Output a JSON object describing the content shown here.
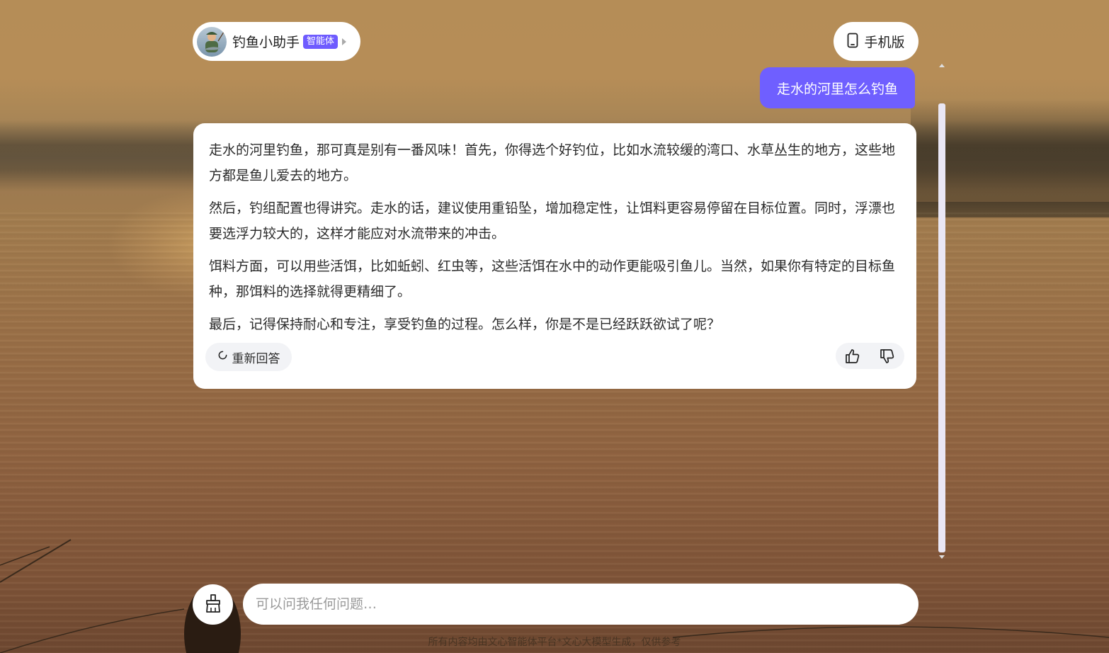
{
  "header": {
    "agent_name": "钓鱼小助手",
    "agent_badge": "智能体",
    "mobile_label": "手机版"
  },
  "conversation": {
    "user_message": "走水的河里怎么钓鱼",
    "answer_paragraphs": [
      "走水的河里钓鱼，那可真是别有一番风味！首先，你得选个好钓位，比如水流较缓的湾口、水草丛生的地方，这些地方都是鱼儿爱去的地方。",
      "然后，钓组配置也得讲究。走水的话，建议使用重铅坠，增加稳定性，让饵料更容易停留在目标位置。同时，浮漂也要选浮力较大的，这样才能应对水流带来的冲击。",
      "饵料方面，可以用些活饵，比如蚯蚓、红虫等，这些活饵在水中的动作更能吸引鱼儿。当然，如果你有特定的目标鱼种，那饵料的选择就得更精细了。",
      "最后，记得保持耐心和专注，享受钓鱼的过程。怎么样，你是不是已经跃跃欲试了呢？"
    ],
    "regenerate_label": "重新回答"
  },
  "input": {
    "placeholder": "可以问我任何问题…"
  },
  "footer": {
    "note": "所有内容均由文心智能体平台*文心大模型生成，仅供参考"
  },
  "icons": {
    "mobile": "mobile-phone-icon",
    "regenerate": "refresh-icon",
    "like": "thumbs-up-icon",
    "dislike": "thumbs-down-icon",
    "clear": "broom-icon"
  },
  "colors": {
    "accent": "#6f5fff",
    "badge": "#6e5bff",
    "card_bg": "#ffffff",
    "button_bg": "#f2f3f6"
  }
}
